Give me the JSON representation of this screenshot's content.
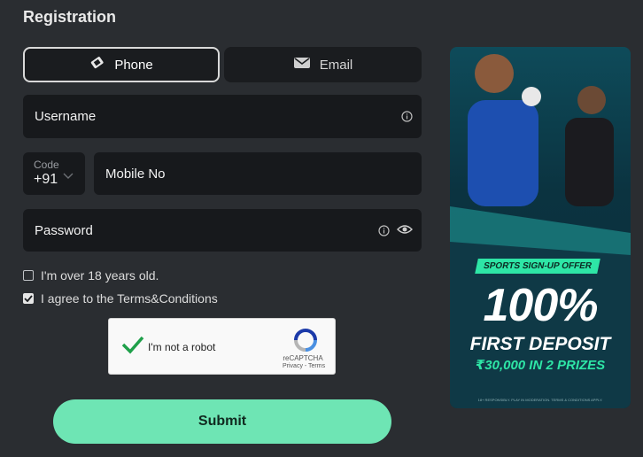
{
  "form": {
    "title": "Registration",
    "tabs": [
      {
        "label": "Phone",
        "icon": "phone-icon",
        "active": true
      },
      {
        "label": "Email",
        "icon": "envelope-icon",
        "active": false
      }
    ],
    "username_label": "Username",
    "code_label": "Code",
    "code_value": "+91",
    "mobile_label": "Mobile No",
    "password_label": "Password",
    "age_check_label": "I'm over 18 years old.",
    "age_checked": false,
    "terms_check_label": "I agree to the Terms&Conditions",
    "terms_checked": true,
    "submit_label": "Submit"
  },
  "captcha": {
    "text": "I'm not a robot",
    "brand": "reCAPTCHA",
    "links": "Privacy - Terms",
    "checked": true
  },
  "banner": {
    "badge": "SPORTS SIGN-UP OFFER",
    "headline": "100%",
    "subheadline": "FIRST DEPOSIT",
    "prize": "₹30,000 IN 2 PRIZES",
    "footnote": "18+ RESPONSIBLY. PLAY IN MODERATION. TERMS & CONDITIONS APPLY."
  },
  "colors": {
    "background": "#2a2d31",
    "field": "#17191c",
    "accent": "#6ee5b4",
    "banner_accent": "#2ee6a6"
  }
}
